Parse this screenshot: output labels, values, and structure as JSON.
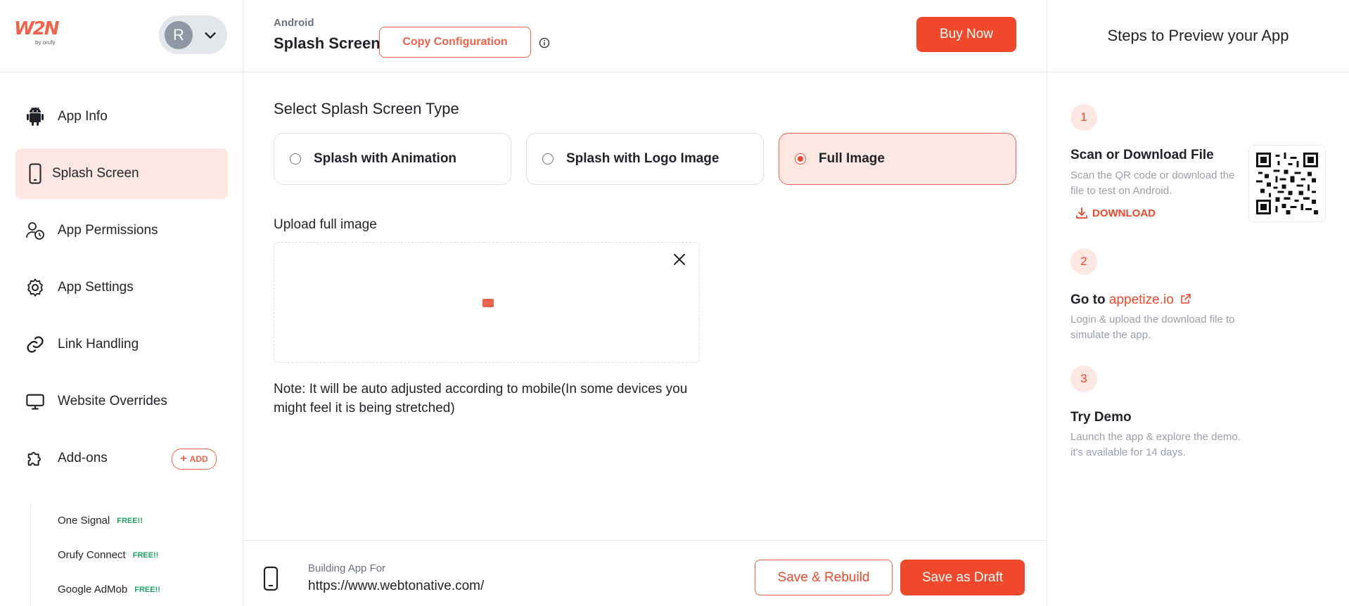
{
  "sidebar": {
    "logo_text": "W2N",
    "logo_sub": "by orufy",
    "user_initial": "R",
    "items": [
      {
        "label": "App Info",
        "icon": "android-icon"
      },
      {
        "label": "Splash Screen",
        "icon": "phone-icon"
      },
      {
        "label": "App Permissions",
        "icon": "user-clock-icon"
      },
      {
        "label": "App Settings",
        "icon": "gear-icon"
      },
      {
        "label": "Link Handling",
        "icon": "link-icon"
      },
      {
        "label": "Website Overrides",
        "icon": "monitor-icon"
      },
      {
        "label": "Add-ons",
        "icon": "puzzle-icon"
      }
    ],
    "add_label": "ADD",
    "addons": [
      {
        "label": "One Signal",
        "badge": "FREE!!"
      },
      {
        "label": "Orufy Connect",
        "badge": "FREE!!"
      },
      {
        "label": "Google AdMob",
        "badge": "FREE!!"
      }
    ]
  },
  "header": {
    "platform": "Android",
    "title": "Splash Screen",
    "copy_label": "Copy Configuration",
    "buy_label": "Buy Now"
  },
  "main": {
    "section_title": "Select Splash Screen Type",
    "types": [
      {
        "label": "Splash with Animation",
        "selected": false
      },
      {
        "label": "Splash with Logo Image",
        "selected": false
      },
      {
        "label": "Full Image",
        "selected": true
      }
    ],
    "upload_label": "Upload full image",
    "note": "Note: It will be auto adjusted according to mobile(In some devices you might feel it is being stretched)"
  },
  "bottom": {
    "building_label": "Building App For",
    "building_url": "https://www.webtonative.com/",
    "rebuild_label": "Save & Rebuild",
    "draft_label": "Save as Draft"
  },
  "right": {
    "title": "Steps to Preview your App",
    "steps": [
      {
        "num": "1",
        "title": "Scan or Download File",
        "desc": "Scan the QR code or download the file to test on Android.",
        "link": "DOWNLOAD"
      },
      {
        "num": "2",
        "title_prefix": "Go to ",
        "link": "appetize.io",
        "desc": "Login & upload the download file to simulate the app."
      },
      {
        "num": "3",
        "title": "Try Demo",
        "desc": "Launch the app & explore the demo. it's available for 14 days."
      }
    ]
  },
  "colors": {
    "accent": "#f0482a",
    "accent_light": "#fde7e3"
  }
}
